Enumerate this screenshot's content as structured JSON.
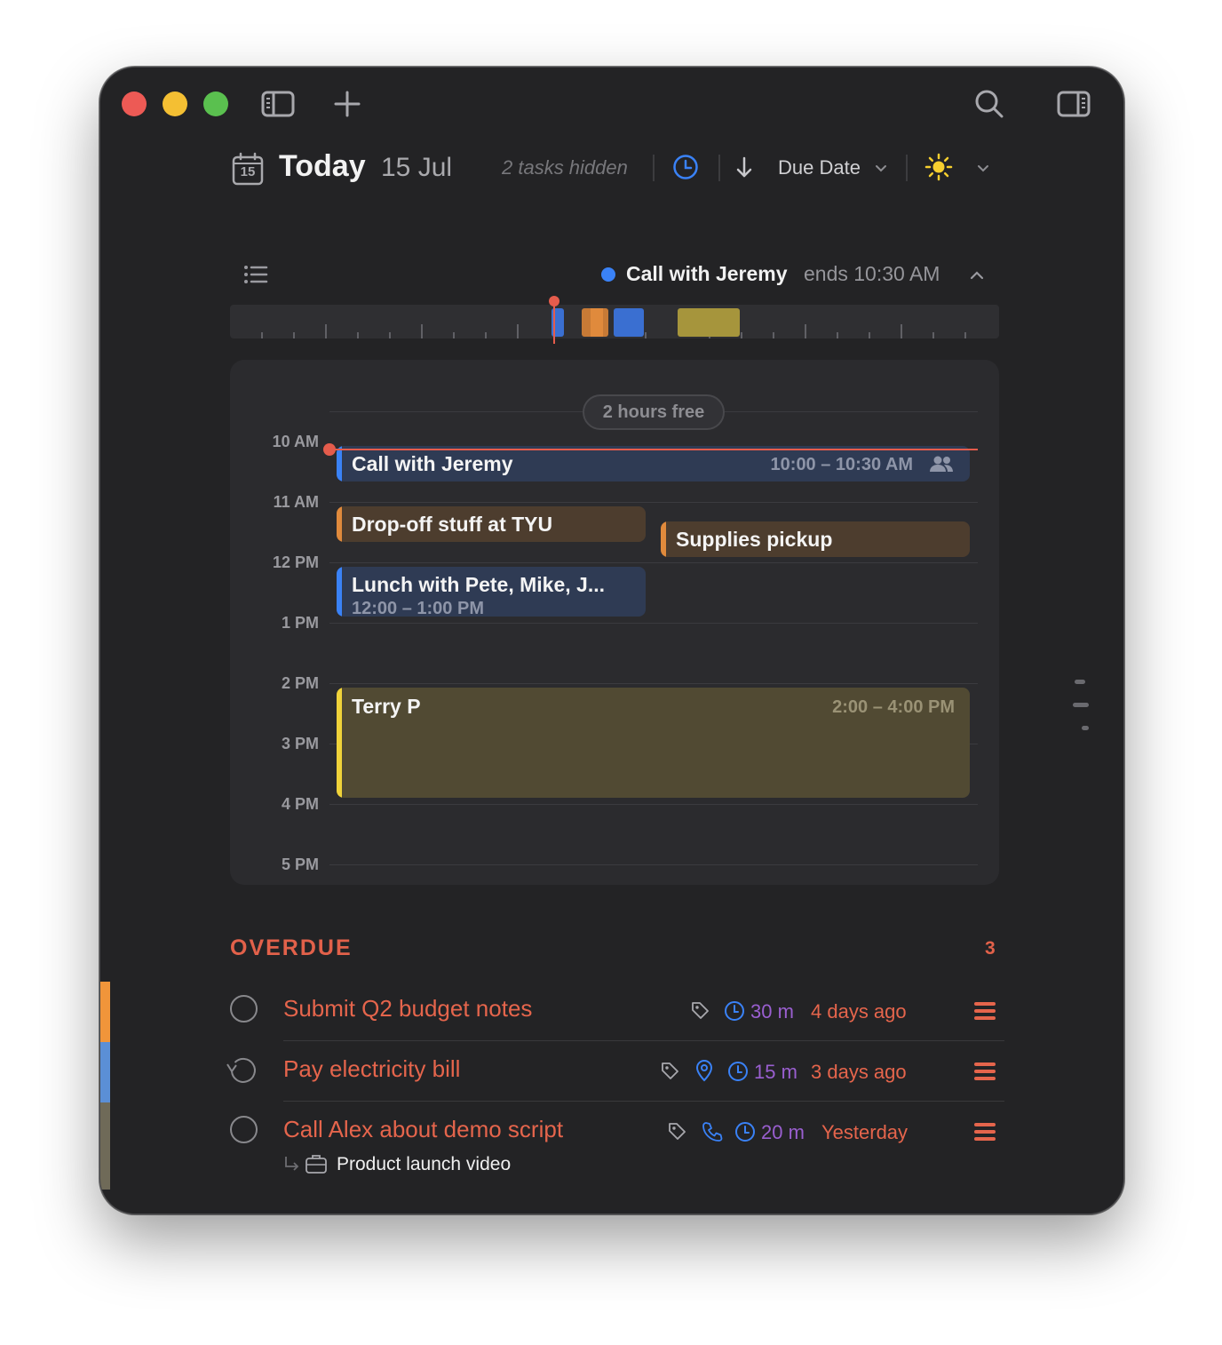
{
  "colors": {
    "window_bg": "#232325",
    "accent_blue": "#3a82f7",
    "overdue_red": "#e2614a",
    "duration_purple": "#9a5fd0",
    "event_blue": "#2f3b54",
    "event_brown": "#4d3d2e",
    "event_olive": "#514a33",
    "now_line": "#e55c4c"
  },
  "toolbar": {
    "icons": [
      "sidebar-toggle-icon",
      "plus-icon",
      "search-icon",
      "inspector-toggle-icon"
    ]
  },
  "header": {
    "calendar_day": "15",
    "title": "Today",
    "date": "15 Jul",
    "hidden_tasks": "2 tasks hidden",
    "sort_label": "Due Date"
  },
  "now_bar": {
    "event": "Call with Jeremy",
    "ends": "ends 10:30 AM"
  },
  "timeline": {
    "free_label": "2 hours free",
    "hours": [
      "10 AM",
      "11 AM",
      "12 PM",
      "1 PM",
      "2 PM",
      "3 PM",
      "4 PM",
      "5 PM"
    ],
    "events": [
      {
        "title": "Call with Jeremy",
        "time": "10:00 – 10:30 AM",
        "color": "blue"
      },
      {
        "title": "Drop-off stuff at TYU",
        "time": "",
        "color": "orange"
      },
      {
        "title": "Supplies pickup",
        "time": "",
        "color": "orange"
      },
      {
        "title": "Lunch with Pete, Mike, J...",
        "time": "12:00 – 1:00 PM",
        "color": "blue"
      },
      {
        "title": "Terry P",
        "time": "2:00 – 4:00 PM",
        "color": "yellow"
      }
    ]
  },
  "overdue": {
    "title": "OVERDUE",
    "count": "3",
    "tasks": [
      {
        "title": "Submit Q2 budget notes",
        "duration": "30 m",
        "when": "4 days ago",
        "icons": [
          "tag-icon",
          "clock-icon"
        ]
      },
      {
        "title": "Pay electricity bill",
        "duration": "15 m",
        "when": "3 days ago",
        "icons": [
          "tag-icon",
          "location-icon",
          "clock-icon"
        ],
        "repeating": true
      },
      {
        "title": "Call Alex about demo script",
        "duration": "20 m",
        "when": "Yesterday",
        "icons": [
          "tag-icon",
          "phone-icon",
          "clock-icon"
        ],
        "project": "Product launch video"
      }
    ]
  }
}
